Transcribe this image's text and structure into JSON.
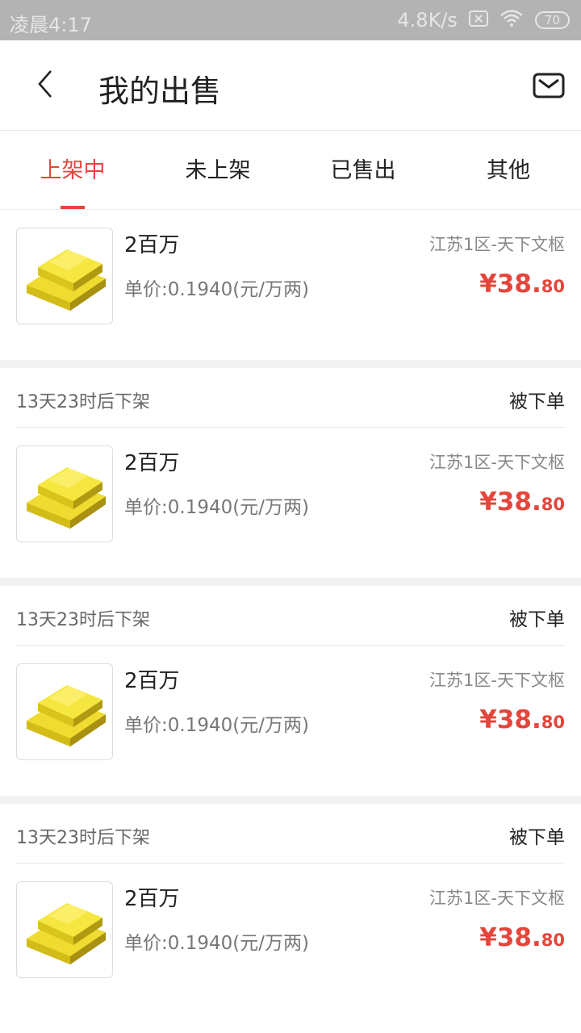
{
  "statusbar": {
    "time": "凌晨4:17",
    "speed": "4.8K/s",
    "battery": "70"
  },
  "header": {
    "title": "我的出售"
  },
  "tabs": [
    {
      "label": "上架中",
      "active": true
    },
    {
      "label": "未上架",
      "active": false
    },
    {
      "label": "已售出",
      "active": false
    },
    {
      "label": "其他",
      "active": false
    }
  ],
  "listings": [
    {
      "expiry": "",
      "status": "",
      "name": "2百万",
      "unit_price": "单价:0.1940(元/万两)",
      "server": "江苏1区-天下文枢",
      "price_main": "¥38.",
      "price_dec": "80"
    },
    {
      "expiry": "13天23时后下架",
      "status": "被下单",
      "name": "2百万",
      "unit_price": "单价:0.1940(元/万两)",
      "server": "江苏1区-天下文枢",
      "price_main": "¥38.",
      "price_dec": "80"
    },
    {
      "expiry": "13天23时后下架",
      "status": "被下单",
      "name": "2百万",
      "unit_price": "单价:0.1940(元/万两)",
      "server": "江苏1区-天下文枢",
      "price_main": "¥38.",
      "price_dec": "80"
    },
    {
      "expiry": "13天23时后下架",
      "status": "被下单",
      "name": "2百万",
      "unit_price": "单价:0.1940(元/万两)",
      "server": "江苏1区-天下文枢",
      "price_main": "¥38.",
      "price_dec": "80"
    }
  ],
  "colors": {
    "accent": "#e5453b",
    "gold": "#e8d020"
  },
  "icons": {
    "back": "chevron-left-icon",
    "mail": "mail-icon",
    "thumbnail": "gold-bars-icon"
  }
}
